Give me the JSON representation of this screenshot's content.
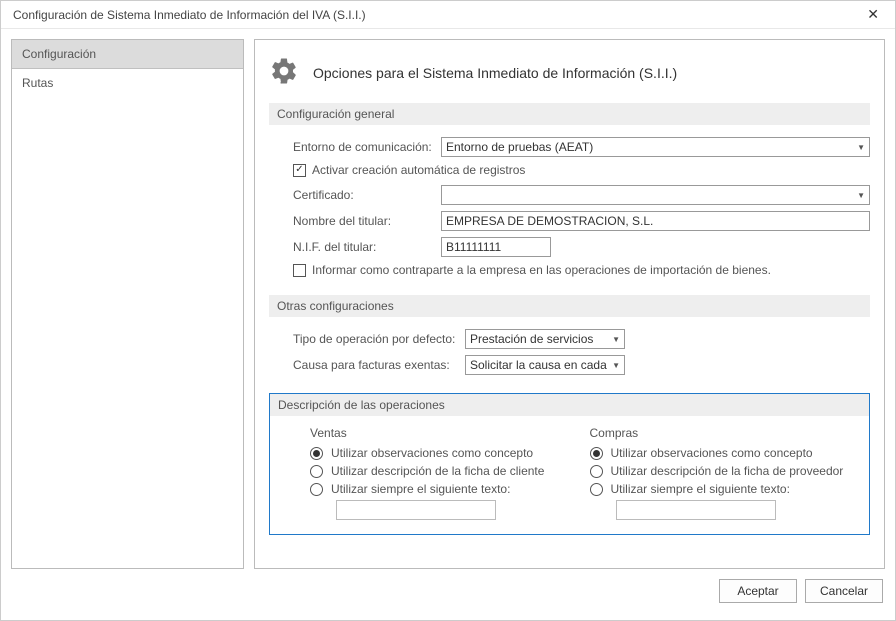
{
  "window": {
    "title": "Configuración de Sistema Inmediato de Información del IVA (S.I.I.)"
  },
  "sidebar": {
    "items": [
      {
        "label": "Configuración",
        "active": true
      },
      {
        "label": "Rutas",
        "active": false
      }
    ]
  },
  "main": {
    "header": "Opciones para el Sistema Inmediato de Información (S.I.I.)",
    "section_general": {
      "title": "Configuración general",
      "entorno_label": "Entorno de comunicación:",
      "entorno_value": "Entorno de pruebas (AEAT)",
      "activar_auto_label": "Activar creación automática de registros",
      "activar_auto_checked": true,
      "certificado_label": "Certificado:",
      "certificado_value": "",
      "nombre_label": "Nombre del titular:",
      "nombre_value": "EMPRESA DE DEMOSTRACION, S.L.",
      "nif_label": "N.I.F. del titular:",
      "nif_value": "B11111111",
      "informar_label": "Informar como contraparte a la empresa en las operaciones de importación de bienes.",
      "informar_checked": false
    },
    "section_otras": {
      "title": "Otras configuraciones",
      "tipo_label": "Tipo de operación por defecto:",
      "tipo_value": "Prestación de servicios",
      "causa_label": "Causa para facturas exentas:",
      "causa_value": "Solicitar la causa en cada"
    },
    "section_desc": {
      "title": "Descripción de las operaciones",
      "ventas": {
        "title": "Ventas",
        "opt1": "Utilizar observaciones como concepto",
        "opt2": "Utilizar descripción de la ficha de cliente",
        "opt3": "Utilizar siempre el siguiente texto:",
        "selected": 0,
        "custom_text": ""
      },
      "compras": {
        "title": "Compras",
        "opt1": "Utilizar observaciones como concepto",
        "opt2": "Utilizar descripción de la ficha de proveedor",
        "opt3": "Utilizar siempre el siguiente texto:",
        "selected": 0,
        "custom_text": ""
      }
    }
  },
  "footer": {
    "accept": "Aceptar",
    "cancel": "Cancelar"
  }
}
